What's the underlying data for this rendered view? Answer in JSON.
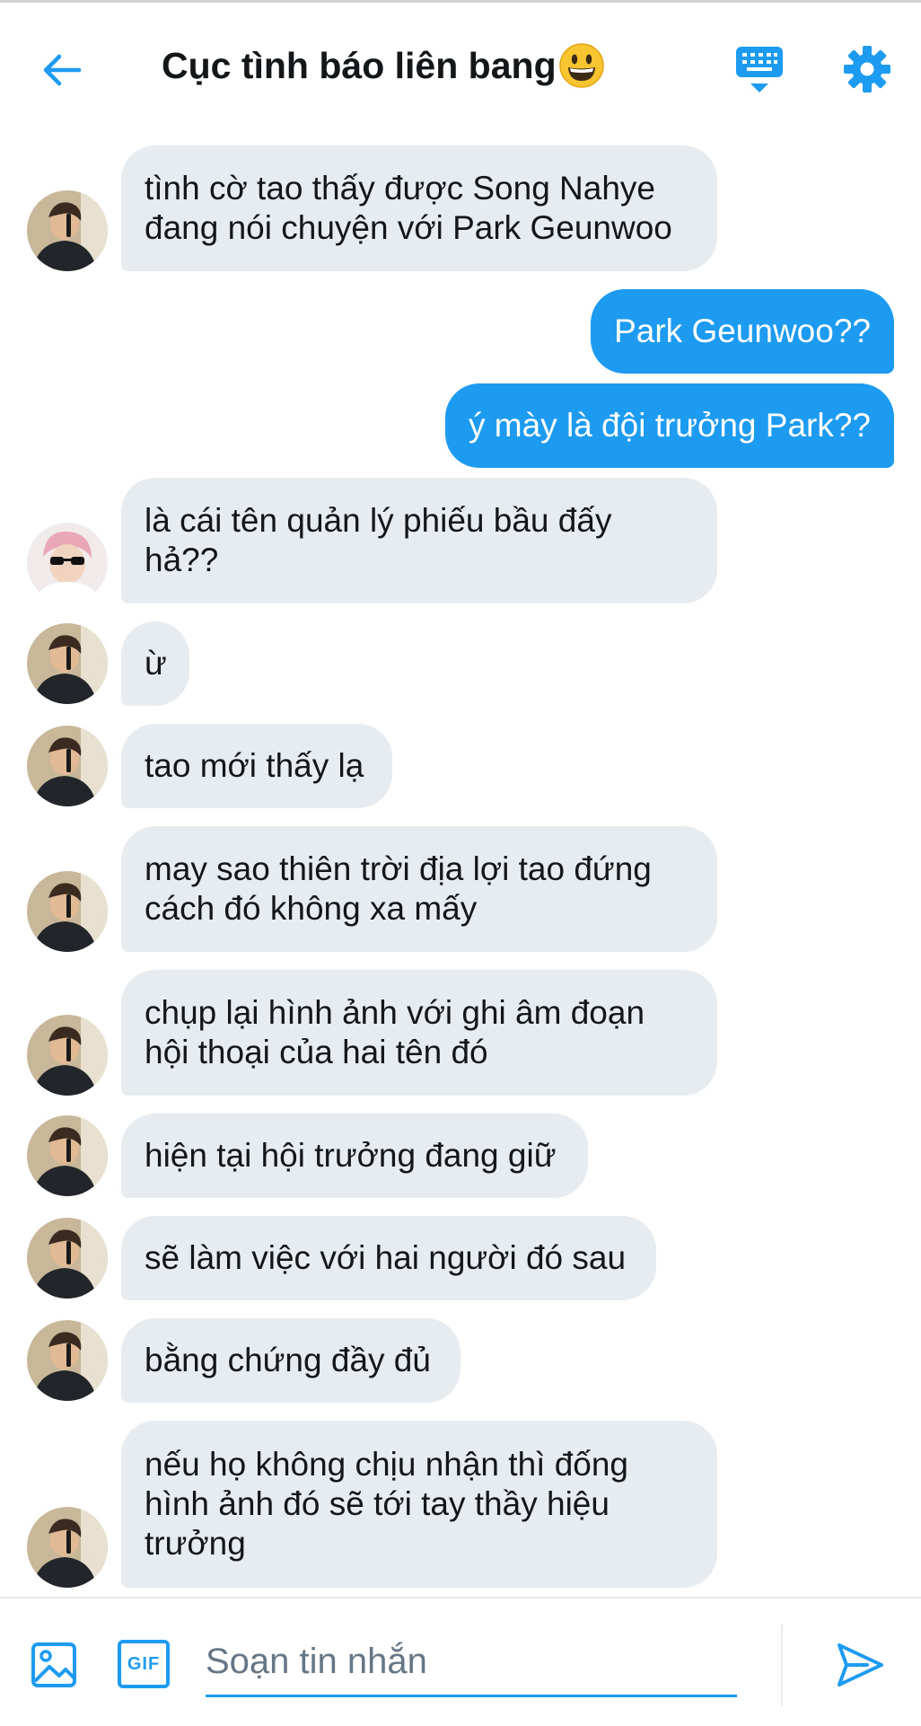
{
  "header": {
    "title": "Cục tình báo liên bang",
    "icons": {
      "back": "back-arrow-icon",
      "emoji": "smiley-emoji-icon",
      "keyboard": "keyboard-icon",
      "settings": "gear-icon"
    }
  },
  "messages": [
    {
      "dir": "in",
      "avatar": "avatar-boy",
      "text": "tình cờ tao thấy được Song Nahye đang nói chuyện với Park Geunwoo"
    },
    {
      "dir": "out",
      "text": "Park Geunwoo??"
    },
    {
      "dir": "out",
      "text": "ý mày là đội trưởng Park??"
    },
    {
      "dir": "in",
      "avatar": "avatar-pink",
      "text": "là cái tên quản lý phiếu bầu đấy hả??"
    },
    {
      "dir": "in",
      "avatar": "avatar-boy",
      "text": "ừ"
    },
    {
      "dir": "in",
      "avatar": "avatar-boy",
      "text": "tao mới thấy lạ"
    },
    {
      "dir": "in",
      "avatar": "avatar-boy",
      "text": "may sao thiên trời địa lợi tao đứng cách đó không xa mấy"
    },
    {
      "dir": "in",
      "avatar": "avatar-boy",
      "text": "chụp lại hình ảnh với ghi âm đoạn hội thoại của hai tên đó"
    },
    {
      "dir": "in",
      "avatar": "avatar-boy",
      "text": "hiện tại hội trưởng đang giữ"
    },
    {
      "dir": "in",
      "avatar": "avatar-boy",
      "text": "sẽ làm việc với hai người đó sau"
    },
    {
      "dir": "in",
      "avatar": "avatar-boy",
      "text": "bằng chứng đầy đủ"
    },
    {
      "dir": "in",
      "avatar": "avatar-boy",
      "text": "nếu họ không chịu nhận thì đống hình ảnh đó sẽ tới tay thầy hiệu trưởng"
    }
  ],
  "composer": {
    "placeholder": "Soạn tin nhắn",
    "gif_label": "GIF",
    "icons": {
      "image": "image-icon",
      "gif": "gif-icon",
      "send": "send-icon"
    }
  },
  "colors": {
    "accent": "#1d9bf0",
    "incoming_bubble": "#e6ecf0",
    "text": "#14171a",
    "placeholder": "#657786"
  }
}
